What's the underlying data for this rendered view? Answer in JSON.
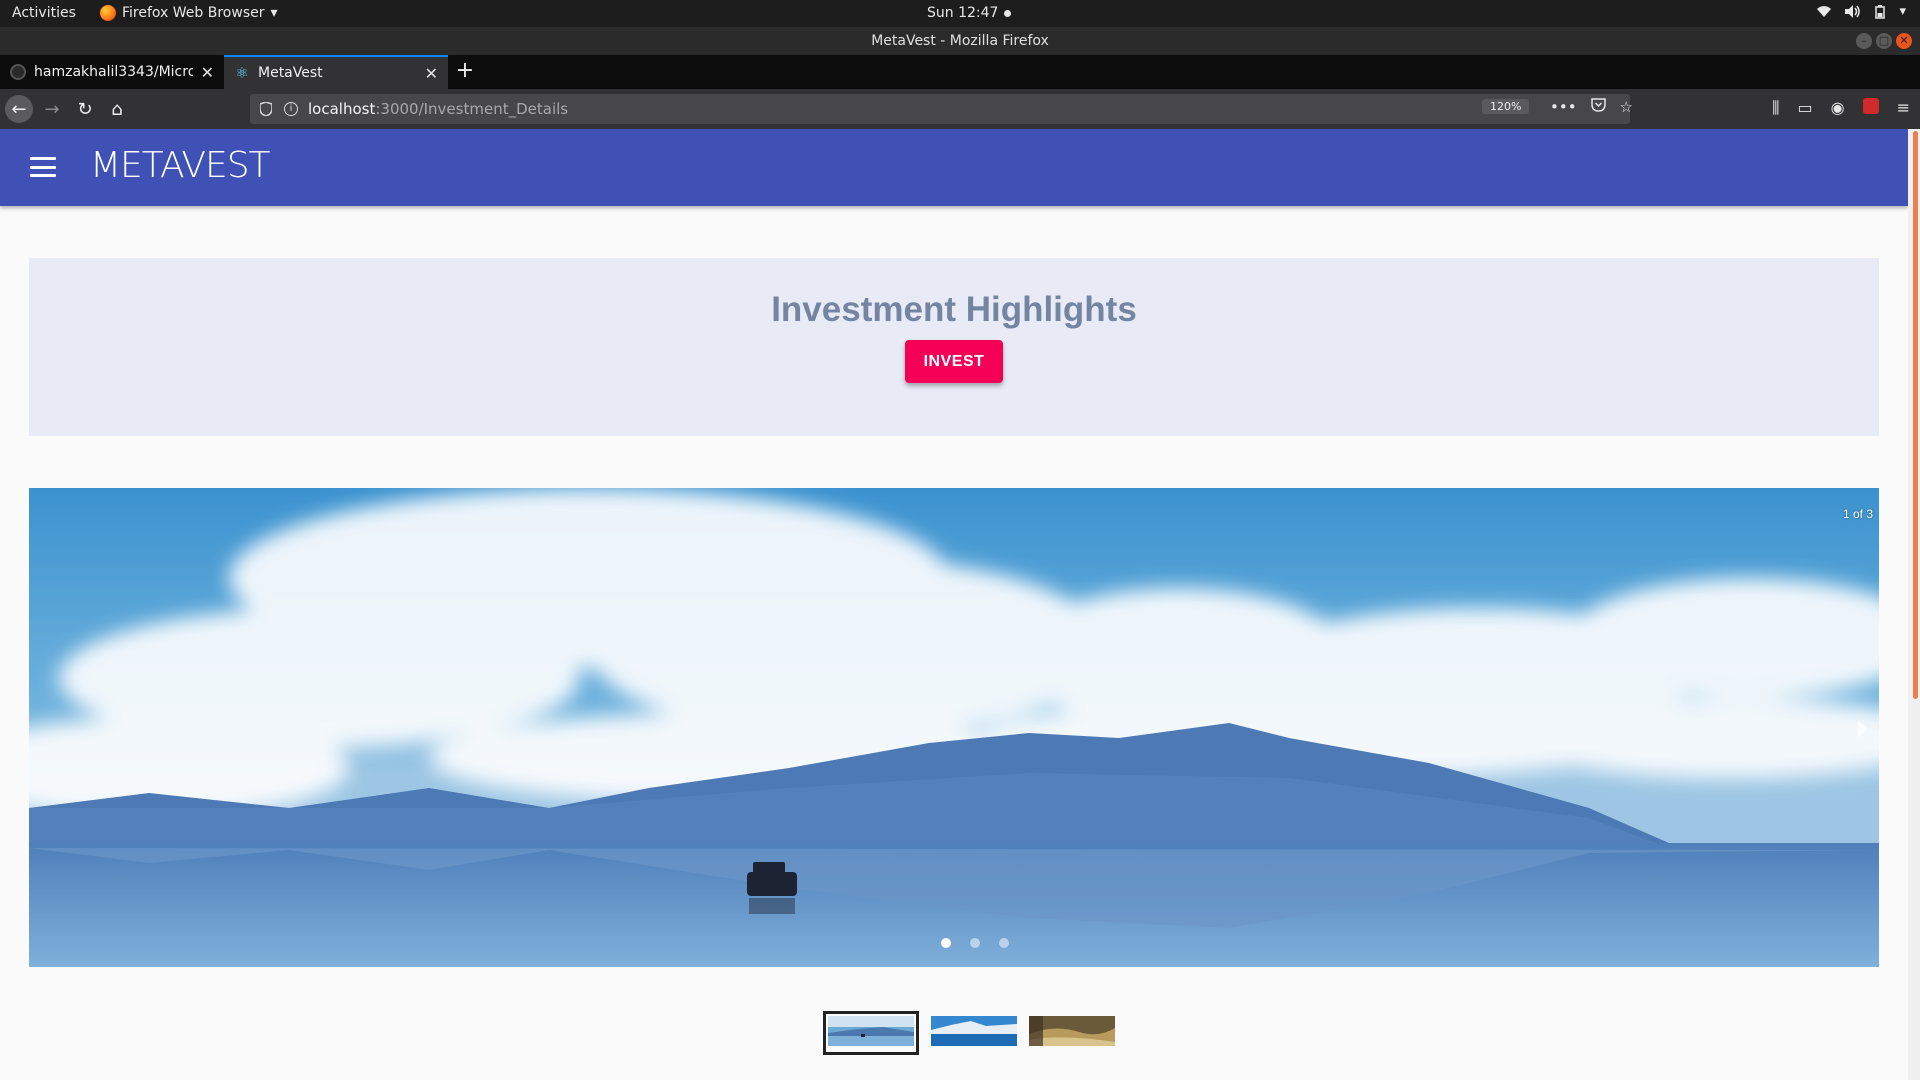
{
  "system_bar": {
    "activities": "Activities",
    "app_menu": "Firefox Web Browser",
    "clock": "Sun 12:47"
  },
  "window": {
    "title": "MetaVest - Mozilla Firefox"
  },
  "tabs": [
    {
      "label": "hamzakhalil3343/Microl",
      "active": false
    },
    {
      "label": "MetaVest",
      "active": true
    }
  ],
  "address_bar": {
    "host": "localhost",
    "path": ":3000/Investment_Details",
    "zoom": "120%"
  },
  "app": {
    "brand": "METAVEST",
    "highlights": {
      "title": "Investment Highlights",
      "invest_label": "INVEST"
    },
    "carousel": {
      "counter": "1 of 3",
      "current_slide": 1,
      "total_slides": 3
    }
  },
  "colors": {
    "app_bar": "#3f51b5",
    "invest_button": "#f50057",
    "highlights_bg": "#e8eaf6",
    "highlights_title": "#7485a2"
  }
}
